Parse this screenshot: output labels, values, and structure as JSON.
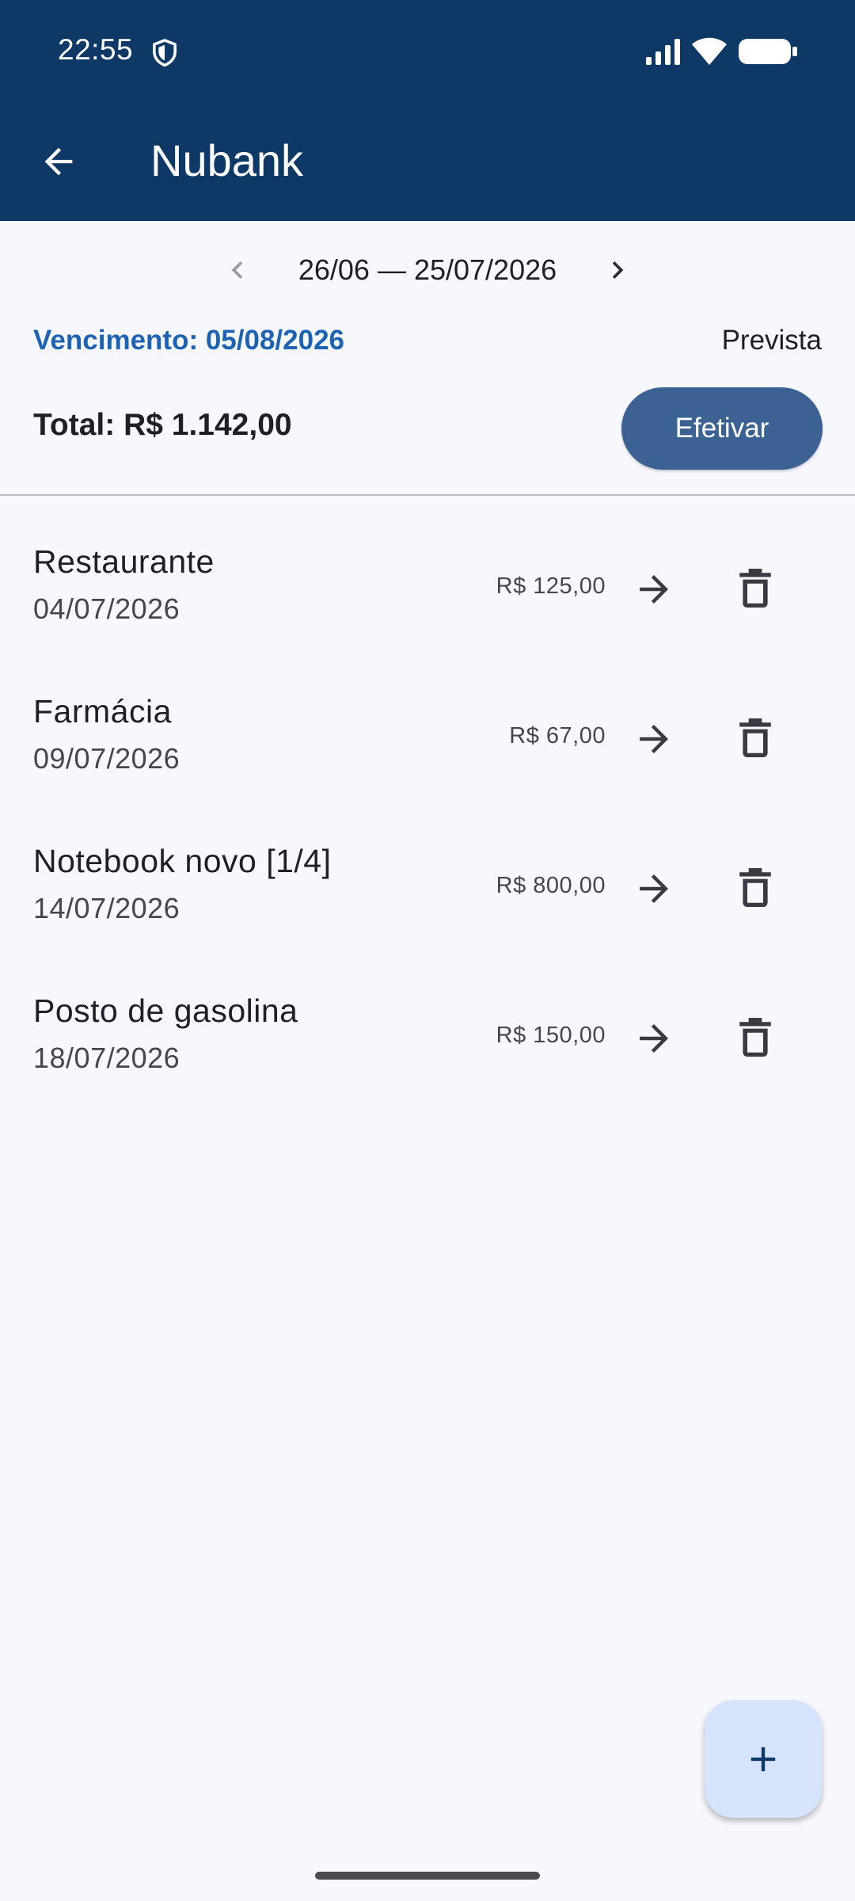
{
  "status_bar": {
    "time": "22:55",
    "icons": [
      "shield-icon",
      "signal-icon",
      "wifi-icon",
      "battery-icon"
    ]
  },
  "app_bar": {
    "title": "Nubank",
    "back_icon": "arrow-back-icon"
  },
  "period": {
    "label": "26/06 — 25/07/2026",
    "prev_icon": "chevron-left-icon",
    "next_icon": "chevron-right-icon"
  },
  "summary": {
    "due_date": "Vencimento: 05/08/2026",
    "status": "Prevista",
    "total": "Total: R$ 1.142,00",
    "efetivar_label": "Efetivar"
  },
  "transactions": [
    {
      "title": "Restaurante",
      "date": "04/07/2026",
      "amount": "R$ 125,00"
    },
    {
      "title": "Farmácia",
      "date": "09/07/2026",
      "amount": "R$ 67,00"
    },
    {
      "title": "Notebook novo [1/4]",
      "date": "14/07/2026",
      "amount": "R$ 800,00"
    },
    {
      "title": "Posto de gasolina",
      "date": "18/07/2026",
      "amount": "R$ 150,00"
    }
  ],
  "colors": {
    "app_bar": "#0e3966",
    "due_date": "#1d63b4",
    "efetivar_button": "#3c6193",
    "fab": "#d5e3fc",
    "background": "#f7f8fd"
  },
  "fab": {
    "icon": "plus-icon"
  }
}
